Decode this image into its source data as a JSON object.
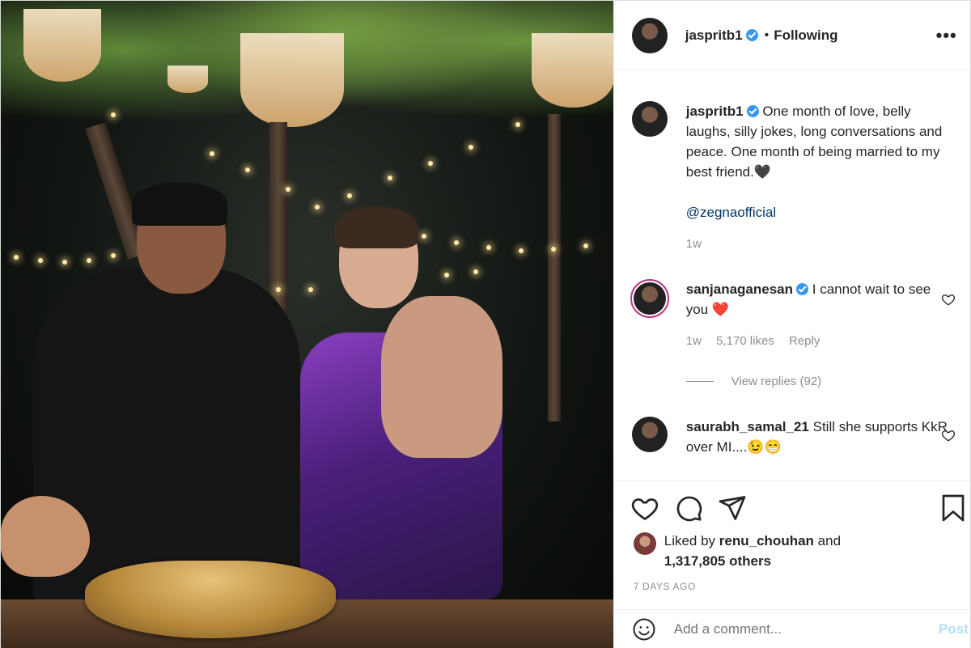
{
  "post": {
    "username": "jaspritb1",
    "follow_status": "Following",
    "more_label": "•••"
  },
  "caption": {
    "username": "jaspritb1",
    "text": "One month of love, belly laughs, silly jokes, long conversations and peace. One month of being married to my best friend.🖤",
    "mention": "@zegnaofficial",
    "time": "1w"
  },
  "comments": [
    {
      "username": "sanjanaganesan",
      "text": "I cannot wait to see you ❤️",
      "time": "1w",
      "likes": "5,170 likes",
      "reply_label": "Reply",
      "view_replies": "View replies (92)"
    },
    {
      "username": "saurabh_samal_21",
      "text": "Still she supports KkR over MI....😉😁"
    }
  ],
  "likes": {
    "liked_by_prefix": "Liked by",
    "liked_by_user": "renu_chouhan",
    "and_label": "and",
    "others": "1,317,805 others"
  },
  "date": "7 DAYS AGO",
  "add_comment": {
    "placeholder": "Add a comment...",
    "post_label": "Post"
  },
  "colors": {
    "verified": "#3897f0",
    "mention": "#00376b",
    "post_disabled": "#b2dffc",
    "story_ring": "#c13584"
  },
  "icons": [
    "verified-badge-icon",
    "more-options-icon",
    "heart-icon",
    "comment-icon",
    "share-icon",
    "bookmark-icon",
    "emoji-icon"
  ]
}
